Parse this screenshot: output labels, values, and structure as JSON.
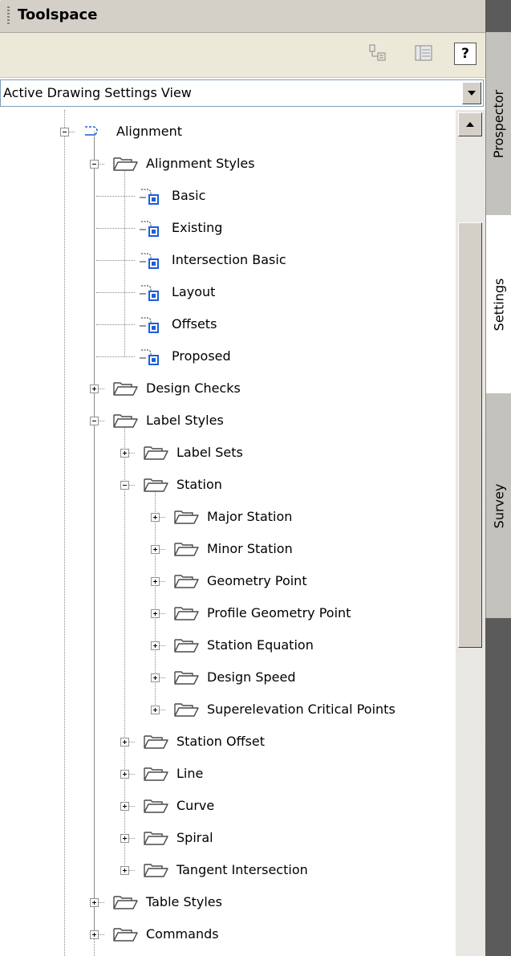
{
  "toolspace": {
    "title": "Toolspace",
    "view_selector": {
      "value": "Active Drawing Settings View"
    },
    "toolbar": {
      "help_label": "?"
    },
    "tabs": [
      {
        "label": "Prospector",
        "active": false
      },
      {
        "label": "Settings",
        "active": true
      },
      {
        "label": "Survey",
        "active": false
      }
    ]
  },
  "tree": {
    "root": "Alignment",
    "alignment_styles": {
      "label": "Alignment Styles",
      "items": [
        "Basic",
        "Existing",
        "Intersection Basic",
        "Layout",
        "Offsets",
        "Proposed"
      ]
    },
    "design_checks": "Design Checks",
    "label_styles": {
      "label": "Label Styles",
      "label_sets": "Label Sets",
      "station": {
        "label": "Station",
        "items": [
          "Major Station",
          "Minor Station",
          "Geometry Point",
          "Profile Geometry Point",
          "Station Equation",
          "Design Speed",
          "Superelevation Critical Points"
        ]
      },
      "others": [
        "Station Offset",
        "Line",
        "Curve",
        "Spiral",
        "Tangent Intersection"
      ]
    },
    "table_styles": "Table Styles",
    "commands": "Commands"
  },
  "colors": {
    "folder_outline": "#4a4a4a",
    "style_icon_blue": "#1c5fd6",
    "tab_active": "#ffffff",
    "tab_inactive": "#c4c2bc"
  }
}
